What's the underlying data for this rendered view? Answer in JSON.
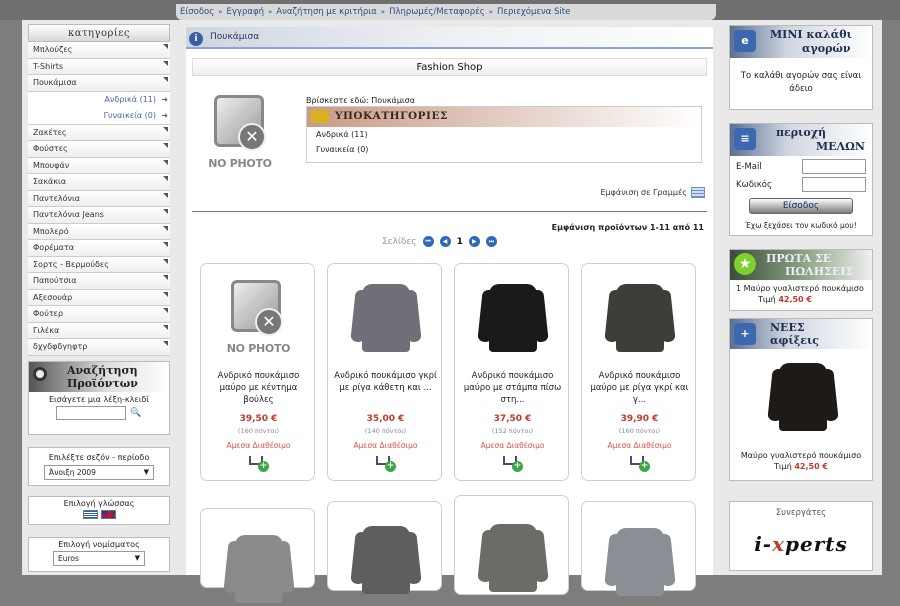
{
  "topnav": {
    "items": [
      "Είσοδος",
      "Εγγραφή",
      "Αναζήτηση με κριτήρια",
      "Πληρωμές/Μεταφορές",
      "Περιεχόμενα Site"
    ],
    "separator": "»"
  },
  "categories": {
    "title": "κατηγορίες",
    "items": [
      "Μπλούζες",
      "T-Shirts",
      "Πουκάμισα"
    ],
    "subitems": [
      "Ανδρικά (11)",
      "Γυναικεία (0)"
    ],
    "items2": [
      "Ζακέτες",
      "Φούστες",
      "Μπουφάν",
      "Σακάκια",
      "Παντελόνια",
      "Παντελόνια Jeans",
      "Μπολερό",
      "Φορέματα",
      "Σορτς - Βερμούδες",
      "Παπούτσια",
      "Αξεσουάρ",
      "Φούτερ",
      "Γιλέκα",
      "δχγδφδγηφτρ"
    ]
  },
  "search": {
    "title1": "Αναζήτηση",
    "title2": "Προϊόντων",
    "label": "Εισάγετε μια λέξη-κλειδί",
    "value": ""
  },
  "season": {
    "label": "Επιλέξτε σεζόν - περίοδο",
    "selected": "Άνοιξη 2009"
  },
  "language": {
    "label": "Επιλογή γλώσσας"
  },
  "currency": {
    "label": "Επιλογή νομίσματος",
    "selected": "Euros"
  },
  "center": {
    "page_title": "Πουκάμισα",
    "shop_title": "Fashion Shop",
    "nophoto": "NO PHOTO",
    "breadcrumb": "Βρίσκεστε εδώ: Πουκάμισα",
    "subcat_title": "ΥΠΟΚΑΤΗΓΟΡΙΕΣ",
    "subcats": [
      "Ανδρικά (11)",
      "Γυναικεία (0)"
    ],
    "view_rows": "Εμφάνιση σε Γραμμές",
    "count_text": "Εμφάνιση προϊόντων 1-11 από 11",
    "pager_label": "Σελίδες",
    "current_page": "1"
  },
  "products": [
    {
      "name": "Ανδρικό πουκάμισο μαύρο με κέντημα βούλες",
      "price": "39,50 €",
      "points": "(160 πόντοι)",
      "avail": "Αμεσα Διαθέσιμο",
      "image": "no-photo"
    },
    {
      "name": "Ανδρικό πουκάμισο γκρί με ρίγα κάθετη και ...",
      "price": "35,00 €",
      "points": "(140 πόντοι)",
      "avail": "Αμεσα Διαθέσιμο",
      "image": "grey-shirt"
    },
    {
      "name": "Ανδρικό πουκάμισο μαύρο με στάμπα πίσω στη...",
      "price": "37,50 €",
      "points": "(152 πόντοι)",
      "avail": "Αμεσα Διαθέσιμο",
      "image": "black-shirt"
    },
    {
      "name": "Ανδρικό πουκάμισο μαύρο με ρίγα γκρί και γ...",
      "price": "39,90 €",
      "points": "(160 πόντοι)",
      "avail": "Αμεσα Διαθέσιμο",
      "image": "dark-shirt"
    }
  ],
  "cart": {
    "title1": "ΜΙΝΙ καλάθι",
    "title2": "αγορών",
    "empty_text": "Το καλάθι αγορών σας είναι άδειο"
  },
  "members": {
    "title1": "περιοχή",
    "title2": "ΜΕΛΩΝ",
    "email_label": "E-Mail",
    "password_label": "Κωδικός",
    "login_button": "Είσοδος",
    "forgot": "Έχω ξεχάσει τον κωδικό μου!"
  },
  "bestsellers": {
    "title1": "ΠΡΩΤΑ ΣΕ",
    "title2": "ΠΩΛΗΣΕΙΣ",
    "rank": "1",
    "item": "Μαύρο γυαλιστερό πουκάμισο",
    "price_label": "Τιμή",
    "price": "42,50 €"
  },
  "new_arrivals": {
    "title1": "ΝΕΕΣ",
    "title2": "αφίξεις",
    "item": "Μαύρο γυαλιστερό πουκάμισο",
    "price_label": "Τιμή",
    "price": "42,50 €"
  },
  "partners": {
    "title": "Συνεργάτες",
    "logo_a": "i-",
    "logo_b": "x",
    "logo_c": "perts"
  },
  "colors": {
    "accent_blue": "#2d4f8a",
    "price_red": "#c0392b",
    "avail_red": "#e05050"
  }
}
